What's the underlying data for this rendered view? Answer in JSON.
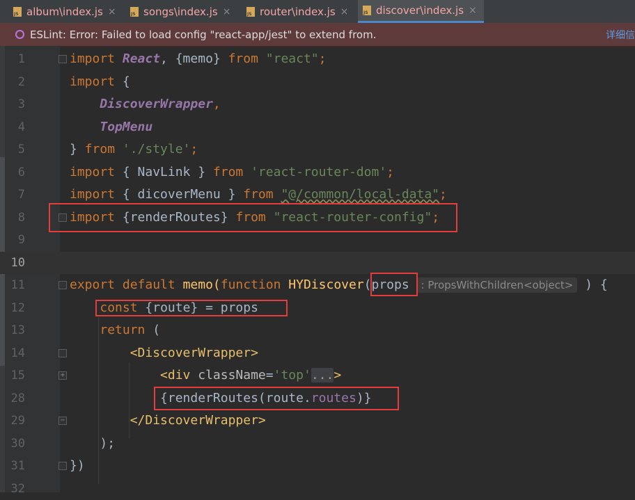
{
  "tabs": [
    {
      "label": "album\\index.js"
    },
    {
      "label": "songs\\index.js"
    },
    {
      "label": "router\\index.js"
    },
    {
      "label": "discover\\index.js"
    }
  ],
  "close_glyph": "×",
  "banner": {
    "message": "ESLint: Error: Failed to load config \"react-app/jest\" to extend from.",
    "more_link": "详细信"
  },
  "line_numbers": [
    "1",
    "2",
    "3",
    "4",
    "5",
    "6",
    "7",
    "8",
    "9",
    "10",
    "11",
    "12",
    "13",
    "14",
    "15",
    "28",
    "29",
    "30",
    "31",
    "32"
  ],
  "code": {
    "l1": {
      "a": "import ",
      "b": "React",
      "c": ", {memo} ",
      "d": "from ",
      "e": "\"react\"",
      "f": ";"
    },
    "l2": {
      "a": "import ",
      "b": "{"
    },
    "l3": {
      "a": "    ",
      "b": "DiscoverWrapper",
      "c": ","
    },
    "l4": {
      "a": "    ",
      "b": "TopMenu"
    },
    "l5": {
      "a": "} ",
      "b": "from ",
      "c": "'./style'",
      "d": ";"
    },
    "l6": {
      "a": "import ",
      "b": "{ NavLink } ",
      "c": "from ",
      "d": "'react-router-dom'",
      "e": ";"
    },
    "l7": {
      "a": "import ",
      "b": "{ dicoverMenu } ",
      "c": "from ",
      "d": "\"@/common/local-data\"",
      "e": ";"
    },
    "l8": {
      "a": "import ",
      "b": "{renderRoutes} ",
      "c": "from ",
      "d": "\"react-router-config\"",
      "e": ";"
    },
    "l11": {
      "a": "export default ",
      "b": "memo(",
      "c": "function ",
      "d": "HYDiscover",
      "e": "(props",
      "hint": ": PropsWithChildren<object>",
      "f": " ) {"
    },
    "l12": {
      "a": "    ",
      "b": "const ",
      "c": "{route} = props"
    },
    "l13": {
      "a": "    ",
      "b": "return ",
      "c": "("
    },
    "l14": {
      "a": "        ",
      "b": "<DiscoverWrapper>"
    },
    "l15": {
      "a": "            ",
      "b": "<div ",
      "c": "className",
      "d": "=",
      "e": "'top'",
      "f": "...",
      "g": ">"
    },
    "l28": {
      "a": "            ",
      "b": "{renderRoutes(route.",
      "c": "routes",
      "d": ")}"
    },
    "l29": {
      "a": "        ",
      "b": "</DiscoverWrapper>"
    },
    "l30": {
      "a": "    ",
      "b": ");"
    },
    "l31": {
      "a": "})"
    }
  },
  "colors": {
    "keyword": "#cc7832",
    "string": "#6a8759",
    "italic_identifier": "#9876aa",
    "function": "#ffc66d",
    "highlight_box": "#e33d3d"
  }
}
